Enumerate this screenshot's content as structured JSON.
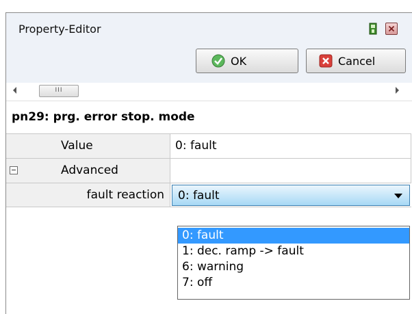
{
  "window": {
    "title": "Property-Editor"
  },
  "toolbar": {
    "ok_label": "OK",
    "cancel_label": "Cancel"
  },
  "scrollbar": {
    "thumb_grip": "III"
  },
  "property": {
    "header": "pn29: prg. error stop. mode"
  },
  "grid": {
    "rows": [
      {
        "label": "Value",
        "value": "0: fault"
      },
      {
        "label": "Advanced",
        "value": ""
      },
      {
        "label": "fault reaction",
        "value": "0: fault"
      }
    ]
  },
  "dropdown": {
    "options": [
      "0: fault",
      "1: dec. ramp -> fault",
      "6: warning",
      "7: off"
    ],
    "selected": "0: fault"
  },
  "colors": {
    "selection": "#3399ff",
    "combo_border": "#3c7fb1"
  },
  "icons": [
    "pin-icon",
    "close-icon",
    "check-icon",
    "cancel-icon",
    "scroll-left-icon",
    "scroll-right-icon",
    "collapse-icon",
    "dropdown-arrow-icon"
  ]
}
